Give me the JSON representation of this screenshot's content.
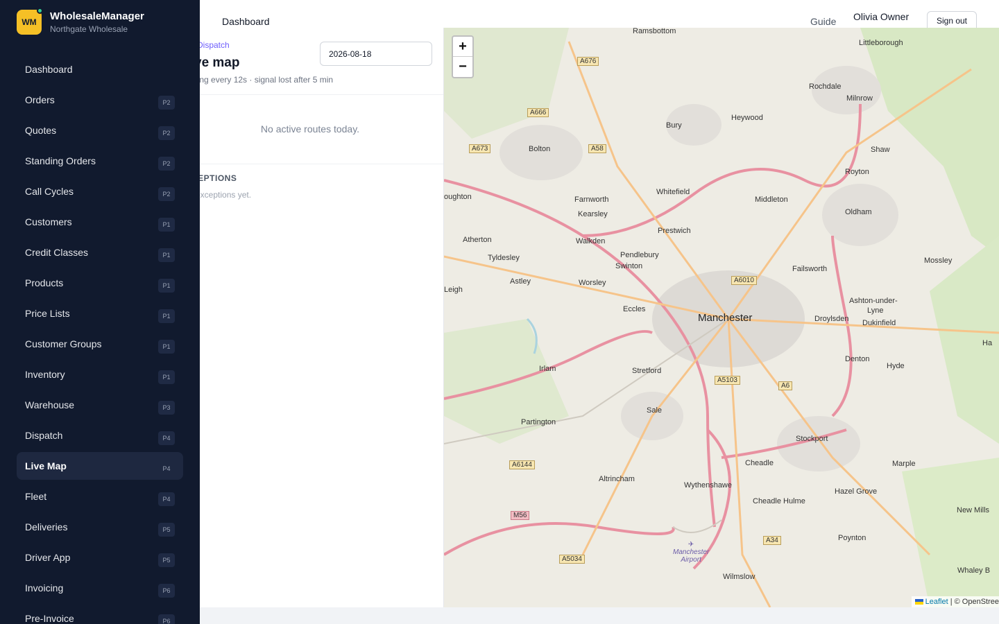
{
  "brand": {
    "logo_text": "WM",
    "name": "WholesaleManager",
    "org": "Northgate Wholesale"
  },
  "sidebar": {
    "items": [
      {
        "label": "Dashboard",
        "badge": ""
      },
      {
        "label": "Orders",
        "badge": "P2"
      },
      {
        "label": "Quotes",
        "badge": "P2"
      },
      {
        "label": "Standing Orders",
        "badge": "P2"
      },
      {
        "label": "Call Cycles",
        "badge": "P2"
      },
      {
        "label": "Customers",
        "badge": "P1"
      },
      {
        "label": "Credit Classes",
        "badge": "P1"
      },
      {
        "label": "Products",
        "badge": "P1"
      },
      {
        "label": "Price Lists",
        "badge": "P1"
      },
      {
        "label": "Customer Groups",
        "badge": "P1"
      },
      {
        "label": "Inventory",
        "badge": "P1"
      },
      {
        "label": "Warehouse",
        "badge": "P3"
      },
      {
        "label": "Dispatch",
        "badge": "P4"
      },
      {
        "label": "Live Map",
        "badge": "P4",
        "active": true
      },
      {
        "label": "Fleet",
        "badge": "P4"
      },
      {
        "label": "Deliveries",
        "badge": "P5"
      },
      {
        "label": "Driver App",
        "badge": "P5"
      },
      {
        "label": "Invoicing",
        "badge": "P6"
      },
      {
        "label": "Pre-Invoice",
        "badge": "P6"
      }
    ]
  },
  "header": {
    "breadcrumb": "Dashboard",
    "guide": "Guide",
    "user": "Olivia Owner",
    "signout": "Sign out"
  },
  "panel": {
    "kicker": "Dispatch",
    "title": "ve map",
    "subtitle": "ling every 12s · signal lost after 5 min",
    "date": "2026-08-18",
    "empty": "No active routes today.",
    "exceptions_heading": "CEPTIONS",
    "exceptions_text": "exceptions yet."
  },
  "map": {
    "zoom_in": "+",
    "zoom_out": "−",
    "attribution_leaflet": "Leaflet",
    "attribution_rest": " | © OpenStree",
    "places": {
      "ramsbottom": "Ramsbottom",
      "littleborough": "Littleborough",
      "rochdale": "Rochdale",
      "milnrow": "Milnrow",
      "bury": "Bury",
      "heywood": "Heywood",
      "bolton": "Bolton",
      "shaw": "Shaw",
      "royton": "Royton",
      "whitefield": "Whitefield",
      "oldham": "Oldham",
      "middleton": "Middleton",
      "farnworth": "Farnworth",
      "kearsley": "Kearsley",
      "prestwich": "Prestwich",
      "atherton": "Atherton",
      "walkden": "Walkden",
      "pendlebury": "Pendlebury",
      "tyldesley": "Tyldesley",
      "swinton": "Swinton",
      "failsworth": "Failsworth",
      "mossley": "Mossley",
      "astley": "Astley",
      "worsley": "Worsley",
      "leigh": "Leigh",
      "eccles": "Eccles",
      "manchester": "Manchester",
      "ashton": "Ashton-under-",
      "lyne": "Lyne",
      "droylsden": "Droylsden",
      "dukinfield": "Dukinfield",
      "denton": "Denton",
      "hyde": "Hyde",
      "irlam": "Irlam",
      "stretford": "Stretford",
      "sale": "Sale",
      "partington": "Partington",
      "stockport": "Stockport",
      "cheadle": "Cheadle",
      "marple": "Marple",
      "altrincham": "Altrincham",
      "wythenshawe": "Wythenshawe",
      "cheadle_hulme": "Cheadle Hulme",
      "hazel_grove": "Hazel Grove",
      "new_mills": "New Mills",
      "poynton": "Poynton",
      "wilmslow": "Wilmslow",
      "whaley": "Whaley B",
      "houghton": "oughton",
      "ha": "Ha",
      "airport_1": "Manchester",
      "airport_2": "Airport"
    },
    "roads": {
      "a676": "A676",
      "a666": "A666",
      "a673": "A673",
      "a58": "A58",
      "a6010": "A6010",
      "a5103": "A5103",
      "a6": "A6",
      "a6144": "A6144",
      "m56": "M56",
      "a34": "A34",
      "a5034": "A5034"
    }
  }
}
